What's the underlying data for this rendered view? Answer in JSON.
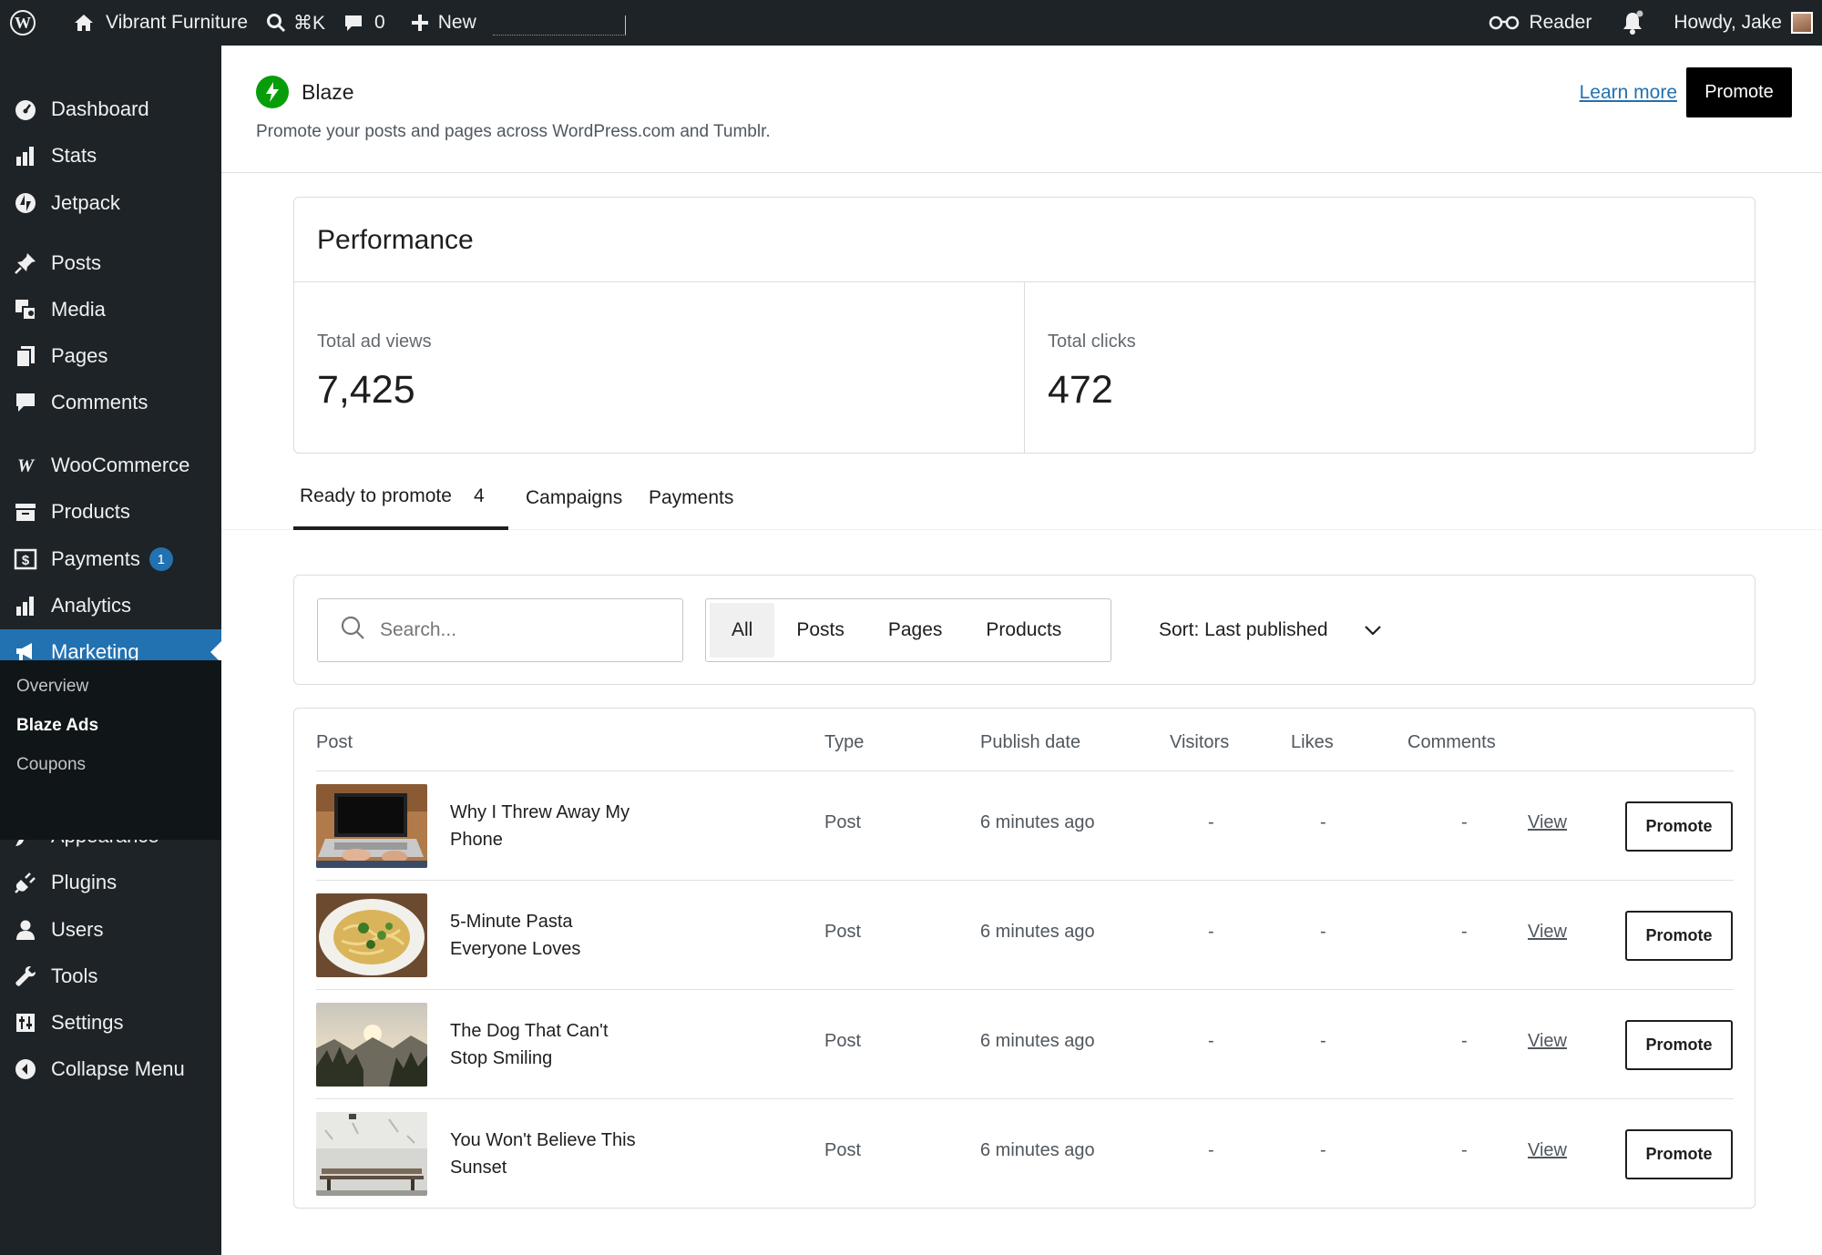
{
  "adminbar": {
    "site_name": "Vibrant Furniture",
    "search_shortcut": "⌘K",
    "comments_count": "0",
    "new_label": "New",
    "reader_label": "Reader",
    "greeting": "Howdy, Jake"
  },
  "sidebar": {
    "items": [
      {
        "label": "Dashboard",
        "icon": "dashboard-icon"
      },
      {
        "label": "Stats",
        "icon": "stats-icon"
      },
      {
        "label": "Jetpack",
        "icon": "jetpack-icon"
      },
      {
        "label": "Posts",
        "icon": "pin-icon"
      },
      {
        "label": "Media",
        "icon": "media-icon"
      },
      {
        "label": "Pages",
        "icon": "pages-icon"
      },
      {
        "label": "Comments",
        "icon": "comment-icon"
      },
      {
        "label": "WooCommerce",
        "icon": "woo-icon"
      },
      {
        "label": "Products",
        "icon": "archive-icon"
      },
      {
        "label": "Payments",
        "icon": "dollar-icon",
        "badge": "1"
      },
      {
        "label": "Analytics",
        "icon": "bar-chart-icon"
      },
      {
        "label": "Marketing",
        "icon": "megaphone-icon",
        "active": true
      },
      {
        "label": "Appearance",
        "icon": "brush-icon"
      },
      {
        "label": "Plugins",
        "icon": "plug-icon"
      },
      {
        "label": "Users",
        "icon": "user-icon"
      },
      {
        "label": "Tools",
        "icon": "wrench-icon"
      },
      {
        "label": "Settings",
        "icon": "settings-icon"
      },
      {
        "label": "Collapse Menu",
        "icon": "collapse-icon"
      }
    ],
    "submenu": [
      {
        "label": "Overview"
      },
      {
        "label": "Blaze Ads",
        "current": true
      },
      {
        "label": "Coupons"
      }
    ]
  },
  "header": {
    "title": "Blaze",
    "subtitle": "Promote your posts and pages across WordPress.com and Tumblr.",
    "learn_more": "Learn more",
    "promote": "Promote"
  },
  "performance": {
    "title": "Performance",
    "ad_views_label": "Total ad views",
    "ad_views_value": "7,425",
    "clicks_label": "Total clicks",
    "clicks_value": "472"
  },
  "tabs": [
    {
      "label": "Ready to promote",
      "count": "4",
      "active": true
    },
    {
      "label": "Campaigns"
    },
    {
      "label": "Payments"
    }
  ],
  "filters": {
    "search_placeholder": "Search...",
    "segments": [
      "All",
      "Posts",
      "Pages",
      "Products"
    ],
    "active_segment": "All",
    "sort_label": "Sort: Last published"
  },
  "table": {
    "headers": [
      "Post",
      "Type",
      "Publish date",
      "Visitors",
      "Likes",
      "Comments"
    ],
    "rows": [
      {
        "title": "Why I Threw Away My Phone",
        "type": "Post",
        "date": "6 minutes ago",
        "visitors": "-",
        "likes": "-",
        "comments": "-",
        "view": "View",
        "promote": "Promote",
        "thumb": "laptop-photo"
      },
      {
        "title": "5-Minute Pasta Everyone Loves",
        "type": "Post",
        "date": "6 minutes ago",
        "visitors": "-",
        "likes": "-",
        "comments": "-",
        "view": "View",
        "promote": "Promote",
        "thumb": "pasta-photo"
      },
      {
        "title": "The Dog That Can't Stop Smiling",
        "type": "Post",
        "date": "6 minutes ago",
        "visitors": "-",
        "likes": "-",
        "comments": "-",
        "view": "View",
        "promote": "Promote",
        "thumb": "sunrise-photo"
      },
      {
        "title": "You Won't Believe This Sunset",
        "type": "Post",
        "date": "6 minutes ago",
        "visitors": "-",
        "likes": "-",
        "comments": "-",
        "view": "View",
        "promote": "Promote",
        "thumb": "bench-photo"
      }
    ]
  },
  "colors": {
    "admin_bg": "#1d2327",
    "accent": "#2271b1",
    "blaze_green": "#069e08"
  }
}
